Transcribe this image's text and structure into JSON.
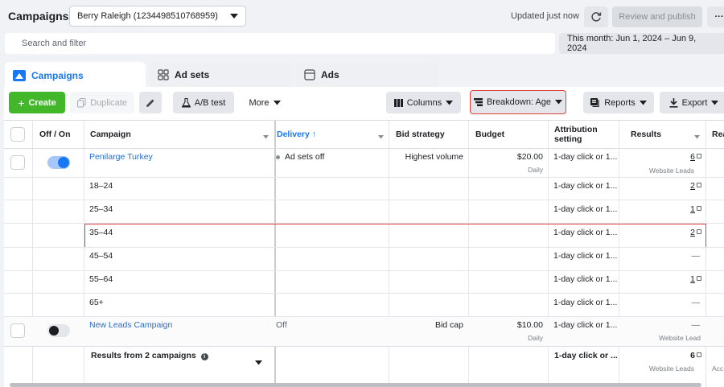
{
  "header": {
    "title": "Campaigns",
    "account": "Berry Raleigh (1234498510768959)",
    "updated": "Updated just now",
    "review_publish": "Review and publish",
    "more": "···"
  },
  "search": {
    "placeholder": "Search and filter"
  },
  "date_range": "This month: Jun 1, 2024 – Jun 9, 2024",
  "tabs": [
    {
      "label": "Campaigns"
    },
    {
      "label": "Ad sets"
    },
    {
      "label": "Ads"
    }
  ],
  "toolbar": {
    "create": "Create",
    "duplicate": "Duplicate",
    "ab_test": "A/B test",
    "more": "More",
    "columns": "Columns",
    "breakdown": "Breakdown: Age",
    "reports": "Reports",
    "export": "Export"
  },
  "table": {
    "headers": {
      "off_on": "Off / On",
      "campaign": "Campaign",
      "delivery": "Delivery ↑",
      "bid_strategy": "Bid strategy",
      "budget": "Budget",
      "attribution": "Attribution setting",
      "results": "Results",
      "reach": "Rea"
    },
    "campaign1": {
      "name": "Penilarge Turkey",
      "delivery": "Ad sets off",
      "bid": "Highest volume",
      "budget": "$20.00",
      "budget_type": "Daily",
      "attribution": "1-day click or 1...",
      "results": "6",
      "results_type": "Website Leads",
      "toggle_on": true
    },
    "age_rows": [
      {
        "age": "18–24",
        "attribution": "1-day click or 1...",
        "results": "2"
      },
      {
        "age": "25–34",
        "attribution": "1-day click or 1...",
        "results": "1"
      },
      {
        "age": "35–44",
        "attribution": "1-day click or 1...",
        "results": "2"
      },
      {
        "age": "45–54",
        "attribution": "1-day click or 1...",
        "results": "—"
      },
      {
        "age": "55–64",
        "attribution": "1-day click or 1...",
        "results": "1"
      },
      {
        "age": "65+",
        "attribution": "1-day click or 1...",
        "results": "—"
      }
    ],
    "campaign2": {
      "name": "New Leads Campaign",
      "delivery": "Off",
      "bid": "Bid cap",
      "budget": "$10.00",
      "budget_type": "Daily",
      "attribution": "1-day click or 1...",
      "results": "—",
      "results_type": "Website Lead",
      "toggle_on": false
    },
    "totals": {
      "label": "Results from 2 campaigns",
      "attribution": "1-day click or ...",
      "results": "6",
      "results_type": "Website Leads",
      "reach_type": "Acc"
    }
  },
  "colors": {
    "accent": "#1877f2",
    "create": "#42b72a",
    "link": "#216fdb",
    "highlight": "#e0413b"
  }
}
